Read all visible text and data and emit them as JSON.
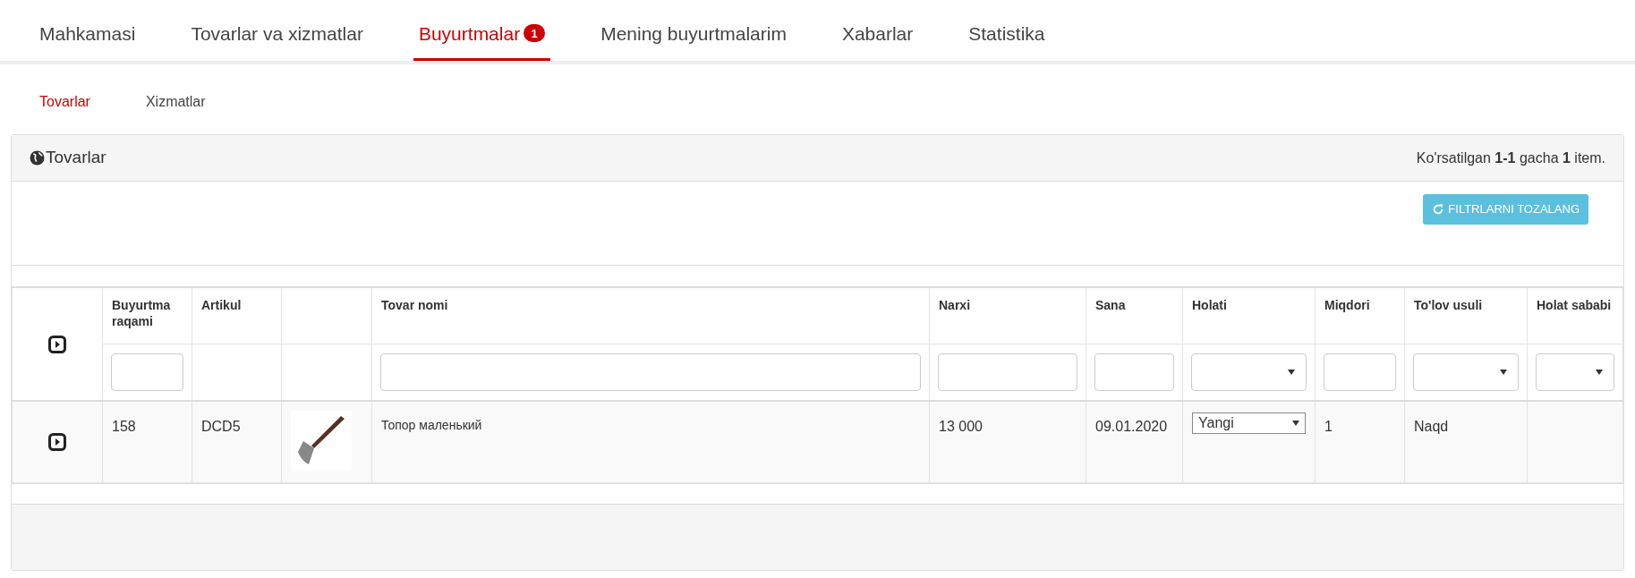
{
  "nav_tabs": [
    {
      "label": "Mahkamasi",
      "selected": false
    },
    {
      "label": "Tovarlar va xizmatlar",
      "selected": false
    },
    {
      "label": "Buyurtmalar",
      "selected": true,
      "badge": "1"
    },
    {
      "label": "Mening buyurtmalarim",
      "selected": false
    },
    {
      "label": "Xabarlar",
      "selected": false
    },
    {
      "label": "Statistika",
      "selected": false
    }
  ],
  "sub_tabs": [
    {
      "label": "Tovarlar",
      "selected": true
    },
    {
      "label": "Xizmatlar",
      "selected": false
    }
  ],
  "panel": {
    "title": "Tovarlar",
    "summary": "Ko'rsatilgan **1-1** gacha **1** item.",
    "clear_button": "FILTRLARNI TOZALANG"
  },
  "table": {
    "columns": [
      {},
      {
        "label": "Buyurtma raqami",
        "filter": {
          "kind": "text"
        }
      },
      {
        "label": "Artikul"
      },
      {},
      {
        "label": "Tovar nomi",
        "filter": {
          "kind": "text"
        }
      },
      {
        "label": "Narxi",
        "filter": {
          "kind": "text"
        }
      },
      {
        "label": "Sana",
        "filter": {
          "kind": "text"
        }
      },
      {
        "label": "Holati",
        "filter": {
          "kind": "select"
        }
      },
      {
        "label": "Miqdori",
        "filter": {
          "kind": "text"
        }
      },
      {
        "label": "To'lov usuli",
        "filter": {
          "kind": "select"
        }
      },
      {
        "label": "Holat sababi",
        "filter": {
          "kind": "select"
        }
      }
    ],
    "rows": [
      {
        "number": "158",
        "article": "DCD5",
        "name": "Топор маленький",
        "price": "13 000",
        "date": "09.01.2020",
        "status": "Yangi",
        "quantity": "1",
        "payment": "Naqd"
      }
    ]
  }
}
